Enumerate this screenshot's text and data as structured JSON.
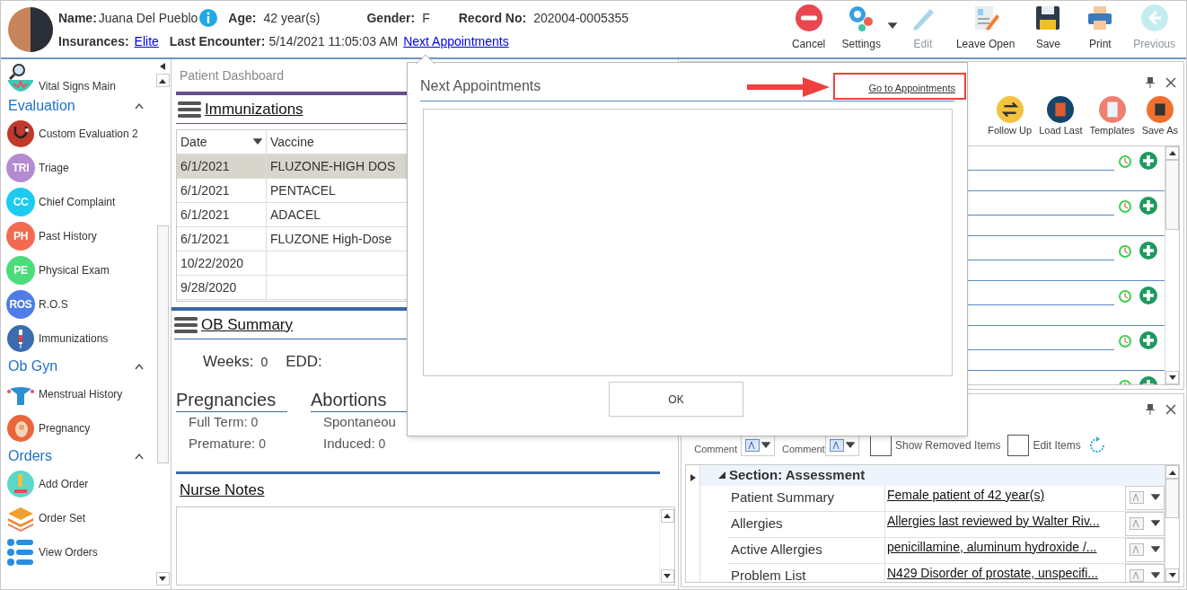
{
  "patient": {
    "name_label": "Name:",
    "name": "Juana Del Pueblo",
    "age_label": "Age:",
    "age": "42 year(s)",
    "gender_label": "Gender:",
    "gender": "F",
    "record_label": "Record No:",
    "record": "202004-0005355",
    "insurances_label": "Insurances:",
    "insurance": "Elite",
    "last_encounter_label": "Last Encounter:",
    "last_encounter": "5/14/2021 11:05:03 AM",
    "next_appointments": "Next Appointments"
  },
  "toolbar": [
    {
      "kind": "cancel",
      "label": "Cancel",
      "disabled": false
    },
    {
      "kind": "settings",
      "label": "Settings",
      "disabled": false
    },
    {
      "kind": "edit",
      "label": "Edit",
      "disabled": true
    },
    {
      "kind": "leave",
      "label": "Leave Open",
      "disabled": false
    },
    {
      "kind": "save",
      "label": "Save",
      "disabled": false
    },
    {
      "kind": "print",
      "label": "Print",
      "disabled": false
    },
    {
      "kind": "previous",
      "label": "Previous",
      "disabled": true
    }
  ],
  "sidebar": {
    "top_item": {
      "kind": "vitals",
      "label": "Vital Signs Main"
    },
    "sections": [
      {
        "title": "Evaluation",
        "expanded": true,
        "items": [
          {
            "kind": "stethoscope",
            "label": "Custom Evaluation 2",
            "color": "#c0392b"
          },
          {
            "kind": "badge",
            "badge": "TRI",
            "label": "Triage",
            "color": "#b48bd0"
          },
          {
            "kind": "badge",
            "badge": "CC",
            "label": "Chief Complaint",
            "color": "#1ccbf0"
          },
          {
            "kind": "badge",
            "badge": "PH",
            "label": "Past History",
            "color": "#f26b50"
          },
          {
            "kind": "badge",
            "badge": "PE",
            "label": "Physical Exam",
            "color": "#4cdc7c"
          },
          {
            "kind": "badge",
            "badge": "ROS",
            "label": "R.O.S",
            "color": "#4f7de8"
          },
          {
            "kind": "syringe",
            "label": "Immunizations",
            "color": "#3c6cb0"
          }
        ]
      },
      {
        "title": "Ob Gyn",
        "expanded": true,
        "items": [
          {
            "kind": "uterus",
            "label": "Menstrual History",
            "color": "#2d8fd0"
          },
          {
            "kind": "pregnancy",
            "label": "Pregnancy",
            "color": "#e8663a"
          }
        ]
      },
      {
        "title": "Orders",
        "expanded": true,
        "items": [
          {
            "kind": "microscope",
            "label": "Add Order",
            "color": "#5bd6c8"
          },
          {
            "kind": "layers",
            "label": "Order Set",
            "color": "#f0a030"
          },
          {
            "kind": "list",
            "label": "View Orders",
            "color": "#2a8de0"
          }
        ]
      }
    ]
  },
  "dashboard": {
    "title": "Patient Dashboard",
    "immunizations": {
      "title": "Immunizations",
      "columns": [
        "Date",
        "Vaccine"
      ],
      "rows": [
        {
          "date": "6/1/2021",
          "vaccine": "FLUZONE-HIGH DOS",
          "selected": true
        },
        {
          "date": "6/1/2021",
          "vaccine": "PENTACEL",
          "selected": false
        },
        {
          "date": "6/1/2021",
          "vaccine": "ADACEL",
          "selected": false
        },
        {
          "date": "6/1/2021",
          "vaccine": "FLUZONE High-Dose",
          "selected": false
        },
        {
          "date": "10/22/2020",
          "vaccine": "",
          "selected": false
        },
        {
          "date": "9/28/2020",
          "vaccine": "",
          "selected": false
        }
      ]
    },
    "ob_summary": {
      "title": "OB Summary",
      "weeks_label": "Weeks:",
      "weeks": "0",
      "edd_label": "EDD:",
      "groups": [
        {
          "title": "Pregnancies",
          "items": [
            {
              "label": "Full Term:",
              "value": "0"
            },
            {
              "label": "Premature:",
              "value": "0"
            }
          ]
        },
        {
          "title": "Abortions",
          "items": [
            {
              "label": "Spontaneou",
              "value": ""
            },
            {
              "label": "Induced:",
              "value": "0"
            }
          ]
        }
      ]
    },
    "nurse_notes": {
      "title": "Nurse Notes"
    }
  },
  "popup": {
    "title": "Next Appointments",
    "link": "Go to Appointments",
    "ok": "OK"
  },
  "plan_panel": {
    "buttons": [
      {
        "kind": "follow",
        "label": "Follow Up"
      },
      {
        "kind": "load",
        "label": "Load Last"
      },
      {
        "kind": "templates",
        "label": "Templates"
      },
      {
        "kind": "saveas",
        "label": "Save As"
      }
    ]
  },
  "assessment_panel": {
    "comment_labels": [
      "Comment",
      "Comment"
    ],
    "options": [
      {
        "label": "Show Removed Items",
        "checked": false
      },
      {
        "label": "Edit Items",
        "checked": false
      }
    ],
    "section": {
      "title": "Section: Assessment",
      "expanded": true,
      "rows": [
        {
          "label": "Patient Summary",
          "value": "Female patient of 42 year(s)"
        },
        {
          "label": "Allergies",
          "value": "Allergies last reviewed by Walter Riv..."
        },
        {
          "label": "Active Allergies",
          "value": "penicillamine, aluminum hydroxide /..."
        },
        {
          "label": "Problem List",
          "value": "N429 Disorder of prostate, unspecifi..."
        }
      ]
    }
  }
}
